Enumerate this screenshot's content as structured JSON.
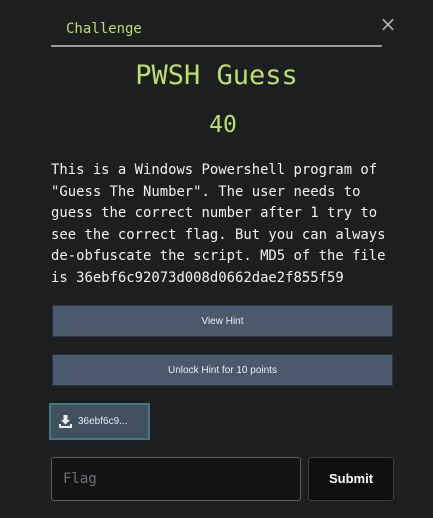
{
  "modal": {
    "tab_label": "Challenge",
    "close_glyph": "×",
    "title": "PWSH Guess",
    "points": "40",
    "description": "This is a Windows Powershell program of \"Guess The Number\". The user needs to guess the correct number after 1 try to see the correct flag. But you can always de-obfuscate the script. MD5 of the file is 36ebf6c92073d008d0662dae2f855f59",
    "view_hint_label": "View Hint",
    "unlock_hint_label": "Unlock Hint for 10 points",
    "file": {
      "icon": "download-icon",
      "label": "36ebf6c9..."
    },
    "flag_input": {
      "value": "",
      "placeholder": "Flag"
    },
    "submit_label": "Submit"
  },
  "colors": {
    "background": "#1c1e1f",
    "accent_green": "#b9e06d",
    "hint_button": "#4a5a6c",
    "file_button_border": "#417b7b"
  }
}
